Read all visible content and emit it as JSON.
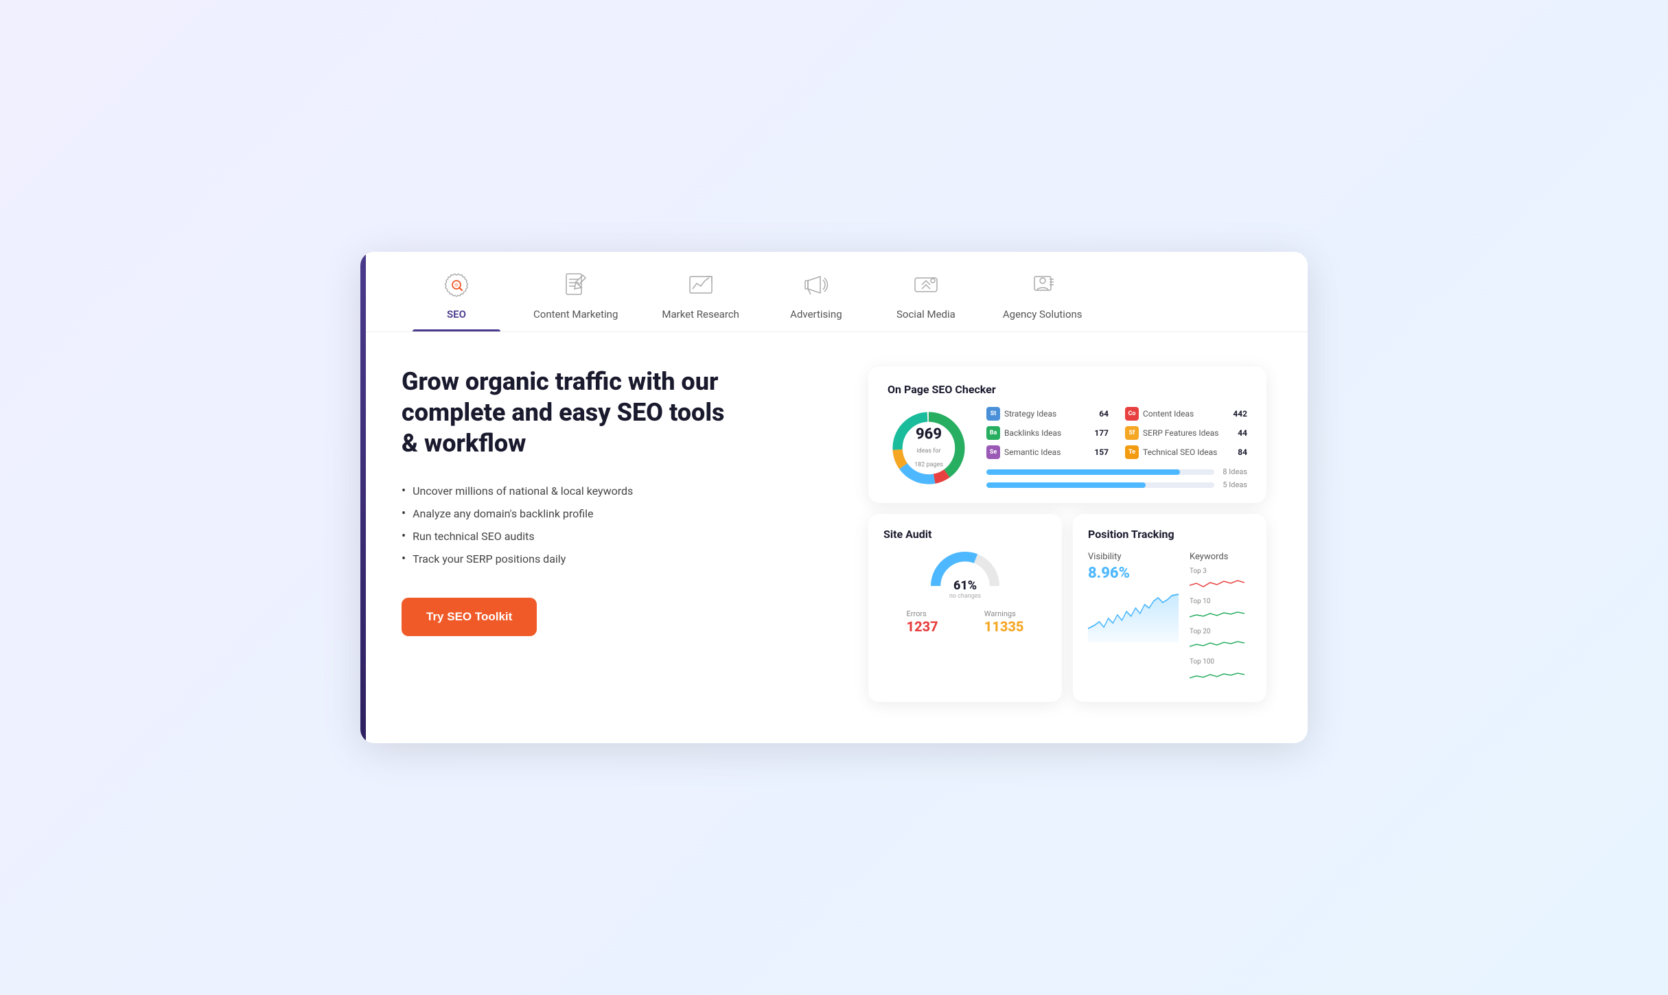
{
  "nav": {
    "tabs": [
      {
        "id": "seo",
        "label": "SEO",
        "active": true
      },
      {
        "id": "content-marketing",
        "label": "Content Marketing",
        "active": false
      },
      {
        "id": "market-research",
        "label": "Market Research",
        "active": false
      },
      {
        "id": "advertising",
        "label": "Advertising",
        "active": false
      },
      {
        "id": "social-media",
        "label": "Social Media",
        "active": false
      },
      {
        "id": "agency-solutions",
        "label": "Agency Solutions",
        "active": false
      }
    ]
  },
  "hero": {
    "headline": "Grow organic traffic with our complete and easy SEO tools & workflow",
    "bullets": [
      "Uncover millions of national & local keywords",
      "Analyze any domain's backlink profile",
      "Run technical SEO audits",
      "Track your SERP positions daily"
    ],
    "cta_label": "Try SEO Toolkit"
  },
  "seo_checker": {
    "title": "On Page SEO Checker",
    "donut": {
      "value": "969",
      "sub": "ideas for\n182 pages"
    },
    "stats": [
      {
        "badge": "St",
        "badge_color": "#4a90d9",
        "label": "Strategy Ideas",
        "value": "64"
      },
      {
        "badge": "Co",
        "badge_color": "#e84040",
        "label": "Content Ideas",
        "value": "442"
      },
      {
        "badge": "Ba",
        "badge_color": "#27ae60",
        "label": "Backlinks Ideas",
        "value": "177"
      },
      {
        "badge": "Sf",
        "badge_color": "#f5a623",
        "label": "SERP Features Ideas",
        "value": "44"
      },
      {
        "badge": "Se",
        "badge_color": "#9b59b6",
        "label": "Semantic Ideas",
        "value": "157"
      },
      {
        "badge": "Te",
        "badge_color": "#f39c12",
        "label": "Technical SEO Ideas",
        "value": "84"
      }
    ],
    "progress_bars": [
      {
        "width": 85,
        "label": "8 Ideas"
      },
      {
        "width": 70,
        "label": "5 Ideas"
      }
    ]
  },
  "site_audit": {
    "title": "Site Audit",
    "percent": "61%",
    "sub_label": "no changes",
    "errors_label": "Errors",
    "errors_value": "1237",
    "warnings_label": "Warnings",
    "warnings_value": "11335"
  },
  "position_tracking": {
    "title": "Position Tracking",
    "visibility_label": "Visibility",
    "visibility_value": "8.96%",
    "keywords_label": "Keywords",
    "keyword_groups": [
      {
        "label": "Top 3",
        "color": "#e84040"
      },
      {
        "label": "Top 10",
        "color": "#27ae60"
      },
      {
        "label": "Top 20",
        "color": "#27ae60"
      },
      {
        "label": "Top 100",
        "color": "#27ae60"
      }
    ]
  },
  "colors": {
    "accent_purple": "#4a3a8c",
    "accent_orange": "#f05a28",
    "donut_green": "#27ae60",
    "donut_red": "#e84040",
    "donut_blue": "#4db8ff",
    "donut_yellow": "#f5a623",
    "donut_teal": "#1abc9c"
  }
}
